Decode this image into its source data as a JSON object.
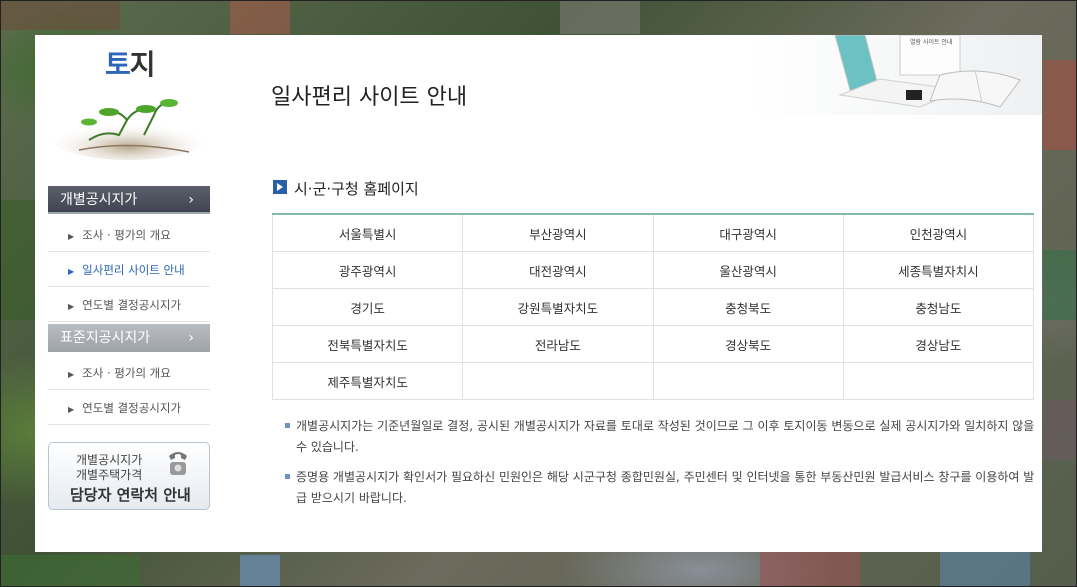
{
  "sidebar": {
    "logo_first": "토",
    "logo_rest": "지",
    "sections": [
      {
        "label": "개별공시지가",
        "items": [
          {
            "label": "조사 · 평가의 개요",
            "active": false
          },
          {
            "label": "일사편리 사이트 안내",
            "active": true
          },
          {
            "label": "연도별 결정공시지가",
            "active": false
          }
        ]
      },
      {
        "label": "표준지공시지가",
        "items": [
          {
            "label": "조사 · 평가의 개요",
            "active": false
          },
          {
            "label": "연도별 결정공시지가",
            "active": false
          }
        ]
      }
    ],
    "contact": {
      "line1": "개별공시지가",
      "line2": "개별주택가격",
      "line3": "담당자 연락처 안내"
    }
  },
  "main": {
    "title": "일사편리 사이트 안내",
    "section_title": "시·군·구청 홈페이지",
    "cities": [
      [
        "서울특별시",
        "부산광역시",
        "대구광역시",
        "인천광역시"
      ],
      [
        "광주광역시",
        "대전광역시",
        "울산광역시",
        "세종특별자치시"
      ],
      [
        "경기도",
        "강원특별자치도",
        "충청북도",
        "충청남도"
      ],
      [
        "전북특별자치도",
        "전라남도",
        "경상북도",
        "경상남도"
      ],
      [
        "제주특별자치도",
        "",
        "",
        ""
      ]
    ],
    "notes": [
      "개별공시지가는 기준년월일로 결정, 공시된 개별공시지가 자료를 토대로 작성된 것이므로 그 이후 토지이동 변동으로 실제 공시지가와 일치하지 않을 수 있습니다.",
      "증명용 개별공시지가 확인서가 필요하신 민원인은 해당 시군구청 종합민원실, 주민센터 및 인터넷을 통한 부동산민원 발급서비스 창구를 이용하여 발급 받으시기 바랍니다."
    ],
    "illustration_caption": "열람 사이트 안내"
  },
  "colors": {
    "accent": "#2b66b8",
    "table_top": "#7fbba5",
    "nav_dark": "#4a4f5b",
    "nav_light": "#a9adb4"
  }
}
